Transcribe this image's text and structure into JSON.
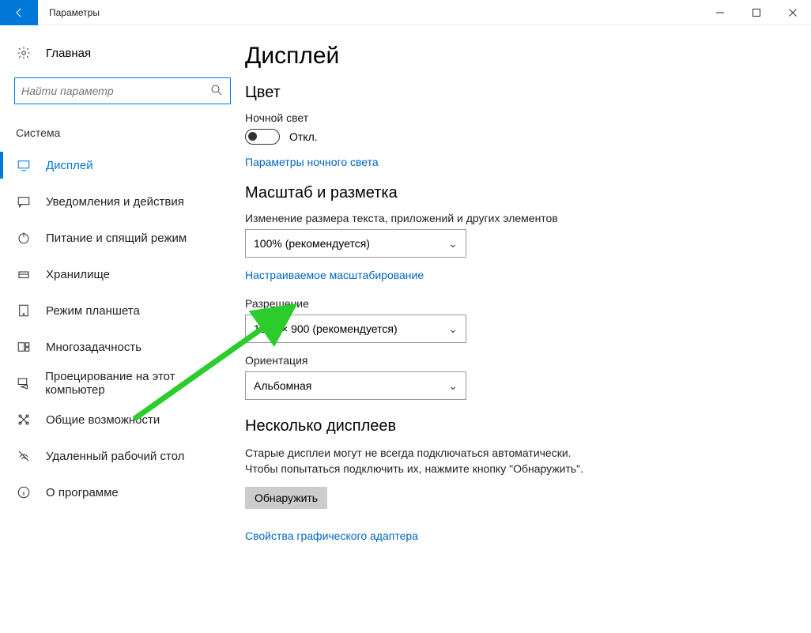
{
  "window": {
    "title": "Параметры"
  },
  "sidebar": {
    "home": "Главная",
    "search_placeholder": "Найти параметр",
    "group": "Система",
    "items": [
      {
        "label": "Дисплей"
      },
      {
        "label": "Уведомления и действия"
      },
      {
        "label": "Питание и спящий режим"
      },
      {
        "label": "Хранилище"
      },
      {
        "label": "Режим планшета"
      },
      {
        "label": "Многозадачность"
      },
      {
        "label": "Проецирование на этот компьютер"
      },
      {
        "label": "Общие возможности"
      },
      {
        "label": "Удаленный рабочий стол"
      },
      {
        "label": "О программе"
      }
    ]
  },
  "main": {
    "title": "Дисплей",
    "color_heading": "Цвет",
    "nightlight_label": "Ночной свет",
    "nightlight_state": "Откл.",
    "nightlight_link": "Параметры ночного света",
    "scale_heading": "Масштаб и разметка",
    "scale_label": "Изменение размера текста, приложений и других элементов",
    "scale_value": "100% (рекомендуется)",
    "custom_scaling_link": "Настраиваемое масштабирование",
    "resolution_label": "Разрешение",
    "resolution_value": "1600 × 900 (рекомендуется)",
    "orientation_label": "Ориентация",
    "orientation_value": "Альбомная",
    "multi_heading": "Несколько дисплеев",
    "multi_para": "Старые дисплеи могут не всегда подключаться автоматически. Чтобы попытаться подключить их, нажмите кнопку \"Обнаружить\".",
    "detect_btn": "Обнаружить",
    "adapter_link": "Свойства графического адаптера"
  }
}
